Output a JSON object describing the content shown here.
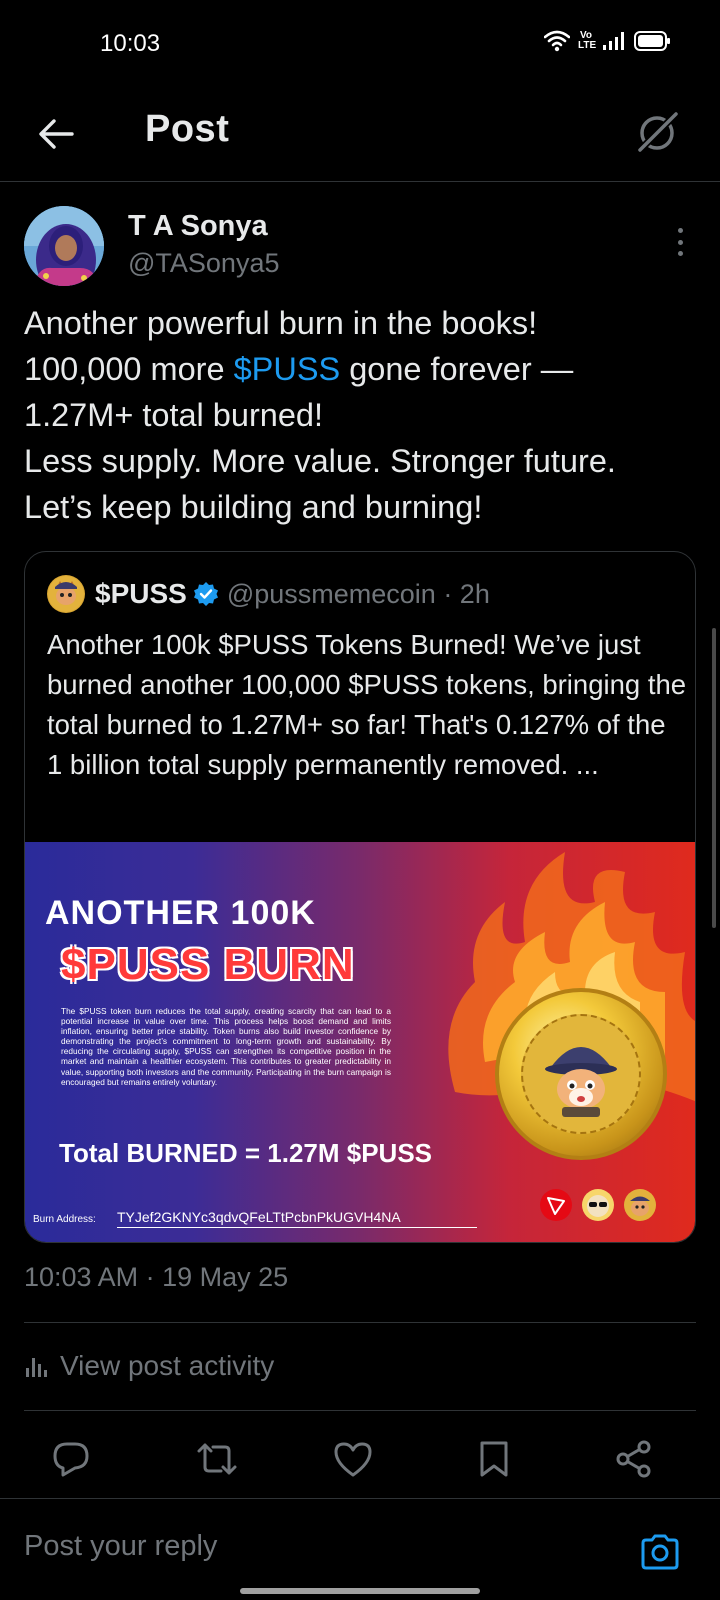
{
  "status": {
    "time": "10:03",
    "network": "Vo LTE"
  },
  "header": {
    "title": "Post"
  },
  "post": {
    "author_name": "T A Sonya",
    "author_handle": "@TASonya5",
    "text_line1": "Another powerful burn in the books!",
    "text_line2_pre": "100,000 more ",
    "text_line2_cashtag": "$PUSS",
    "text_line2_post": " gone forever —",
    "text_line3": "1.27M+ total burned!",
    "text_line4": "Less supply. More value. Stronger future.",
    "text_line5": "Let’s keep building and burning!",
    "timestamp": "10:03 AM · 19 May 25",
    "view_activity": "View post activity"
  },
  "quote": {
    "name": "$PUSS",
    "handle_time": "@pussmemecoin · 2h",
    "text": "Another 100k $PUSS Tokens Burned! We’ve just burned another 100,000 $PUSS tokens, bringing the total burned to 1.27M+ so far! That's 0.127% of the 1 billion total supply permanently removed. ...",
    "banner": {
      "title1": "ANOTHER 100K",
      "title2": "$PUSS BURN",
      "body": "The $PUSS token burn reduces the total supply, creating scarcity that can lead to a potential increase in value over time. This process helps boost demand and limits inflation, ensuring better price stability. Token burns also build investor confidence by demonstrating the project’s commitment to long-term growth and sustainability. By reducing the circulating supply, $PUSS can strengthen its competitive position in the market and maintain a healthier ecosystem. This contributes to greater predictability in value, supporting both investors and the community. Participating in the burn campaign is encouraged but remains entirely voluntary.",
      "total": "Total BURNED = 1.27M $PUSS",
      "address_label": "Burn Address:",
      "address": "TYJef2GKNYc3qdvQFeLTtPcbnPkUGVH4NA"
    }
  },
  "reply": {
    "placeholder": "Post your reply"
  },
  "colors": {
    "accent": "#1d9bf0",
    "muted": "#71767b",
    "text": "#e7e9ea",
    "divider": "#2f3336"
  },
  "icons": [
    "back-arrow-icon",
    "grok-icon",
    "more-vertical-icon",
    "verified-badge-icon",
    "bar-chart-icon",
    "reply-icon",
    "repost-icon",
    "like-icon",
    "bookmark-icon",
    "share-icon",
    "camera-icon"
  ]
}
